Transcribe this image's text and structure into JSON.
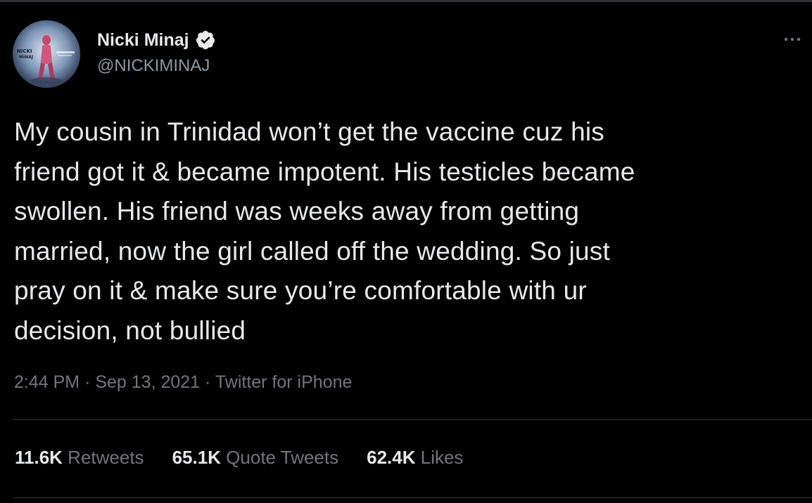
{
  "author": {
    "display_name": "Nicki Minaj",
    "handle": "@NICKIMINAJ",
    "verified": true,
    "avatar_text": "NICKI MINAJ"
  },
  "tweet": {
    "text": "My cousin in Trinidad won’t get the vaccine cuz his\nfriend got it & became impotent. His testicles became\nswollen. His friend was weeks away from getting\nmarried, now the girl called off the wedding. So just\npray on it & make sure you’re comfortable with ur\ndecision, not bullied",
    "time": "2:44 PM",
    "separator": "·",
    "date": "Sep 13, 2021",
    "source": "Twitter for iPhone"
  },
  "stats": [
    {
      "count": "11.6K",
      "label": "Retweets"
    },
    {
      "count": "65.1K",
      "label": "Quote Tweets"
    },
    {
      "count": "62.4K",
      "label": "Likes"
    }
  ],
  "icons": {
    "verified": "verified-badge-icon",
    "more": "more-options-icon"
  },
  "colors": {
    "background": "#000000",
    "text_primary": "#e7e9ea",
    "text_secondary": "#71767b",
    "divider": "#2f3336"
  }
}
